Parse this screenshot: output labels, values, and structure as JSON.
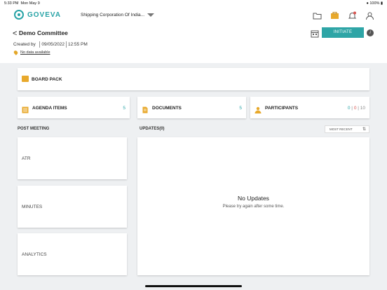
{
  "status_bar": {
    "time": "5:33 PM",
    "date": "Mon May 9",
    "battery": "100%"
  },
  "app": {
    "logo_text": "GOVEVA",
    "organization": "Shipping Corporation Of India..."
  },
  "top_icons": [
    "folder-icon",
    "briefcase-icon",
    "bell-icon",
    "user-icon"
  ],
  "header": {
    "back_symbol": "<",
    "title": "Demo Committee",
    "created_by_label": "Created by",
    "created_date": "09/05/2022",
    "created_time": "12:55 PM",
    "location": "No data available",
    "initiate_label": "INITIATE",
    "info_symbol": "i"
  },
  "board_pack": {
    "label": "BOARD PACK"
  },
  "stats": {
    "agenda": {
      "label": "AGENDA ITEMS",
      "count": "5"
    },
    "documents": {
      "label": "DOCUMENTS",
      "count": "5"
    },
    "participants": {
      "label": "PARTICIPANTS",
      "c1": "0",
      "c2": "0",
      "c3": "10"
    }
  },
  "post_meeting": {
    "heading": "POST MEETING",
    "items": [
      "ATR",
      "MINUTES",
      "ANALYTICS"
    ]
  },
  "updates": {
    "heading": "UPDATES(0)",
    "sort_label": "MOST RECENT",
    "empty_title": "No Updates",
    "empty_subtitle": "Please try again after some time."
  },
  "colors": {
    "accent": "#2ea5a6",
    "icon_orange": "#e8a92c",
    "participant_red": "#d9534f"
  }
}
